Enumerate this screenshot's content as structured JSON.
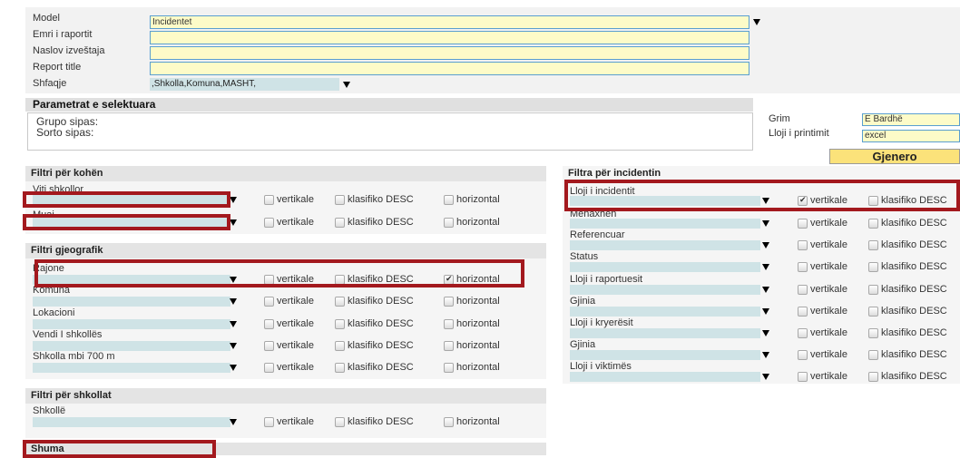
{
  "report": {
    "model_label": "Model",
    "model_value": "Incidentet",
    "emri_label": "Emri i raportit",
    "emri_value": "",
    "naslov_label": "Naslov izveštaja",
    "naslov_value": "",
    "title_label": "Report title",
    "title_value": "",
    "shfaqje_label": "Shfaqje",
    "shfaqje_value": ",Shkolla,Komuna,MASHT,"
  },
  "params": {
    "header": "Parametrat e selektuara",
    "group_by": "Grupo sipas:",
    "sort_by": "Sorto sipas:"
  },
  "print": {
    "grim_label": "Grim",
    "grim_value": "E Bardhë",
    "type_label": "Lloji i printimit",
    "type_value": "excel",
    "generate_label": "Gjenero"
  },
  "options": {
    "vertikale": "vertikale",
    "klasifiko": "klasifiko DESC",
    "horizontal": "horizontal"
  },
  "time_filter": {
    "header": "Filtri për kohën",
    "rows": [
      {
        "label": "Viti shkollor"
      },
      {
        "label": "Muaj"
      }
    ]
  },
  "geo_filter": {
    "header": "Filtri gjeografik",
    "rows": [
      {
        "label": "Rajone",
        "horizontal_checked": true
      },
      {
        "label": "Komuna"
      },
      {
        "label": "Lokacioni"
      },
      {
        "label": "Vendi I shkollës"
      },
      {
        "label": "Shkolla mbi 700 m"
      }
    ]
  },
  "school_filter": {
    "header": "Filtri për shkollat",
    "rows": [
      {
        "label": "Shkollë"
      }
    ]
  },
  "sum_section": {
    "header": "Shuma"
  },
  "incident_filter": {
    "header": "Filtra për incidentin",
    "rows": [
      {
        "label": "Lloji i incidentit",
        "vertikale_checked": true
      },
      {
        "label": "Menaxhen"
      },
      {
        "label": "Referencuar"
      },
      {
        "label": "Status"
      },
      {
        "label": "Lloji i raportuesit"
      },
      {
        "label": "Gjinia"
      },
      {
        "label": "Lloji i kryerësit"
      },
      {
        "label": "Gjinia"
      },
      {
        "label": "Lloji i viktimës"
      }
    ]
  },
  "colors": {
    "highlight_border": "#a3191e",
    "input_yellow": "#fdfbc8",
    "select_teal": "#cfe3e6",
    "button_yellow": "#fbe27a"
  }
}
